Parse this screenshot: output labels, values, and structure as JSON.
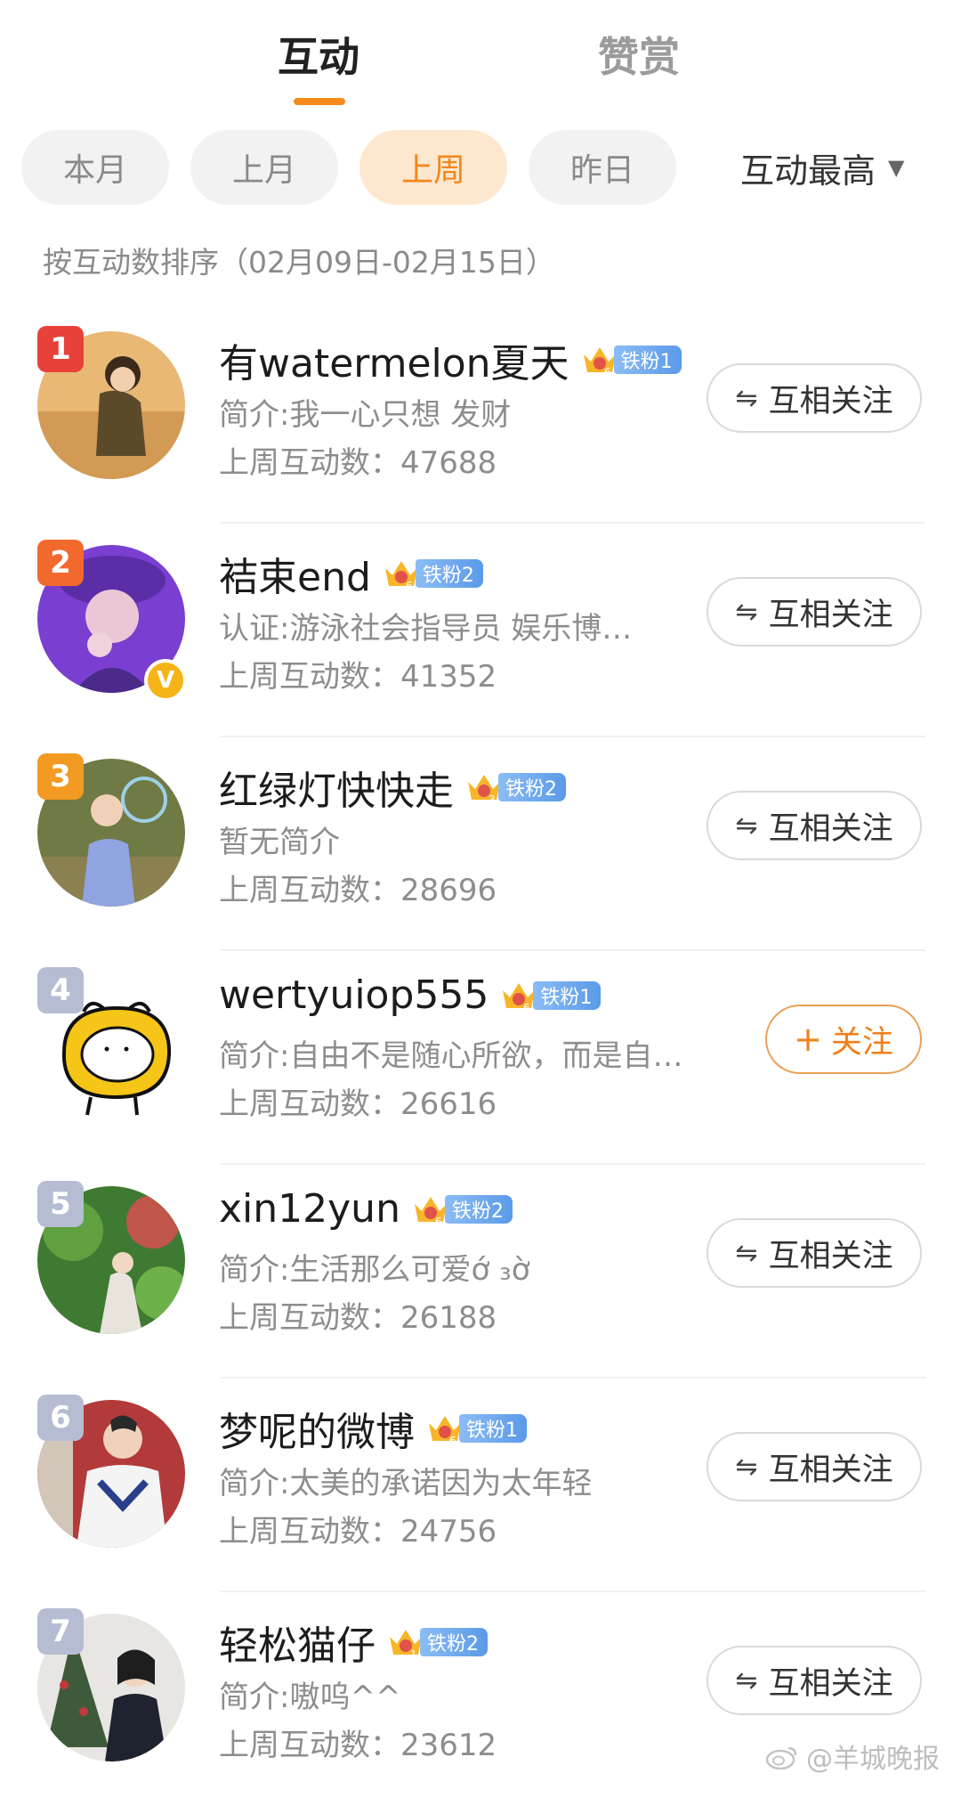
{
  "tabs": {
    "interact": "互动",
    "reward": "赞赏"
  },
  "filters": {
    "chips": [
      "本月",
      "上月",
      "上周",
      "昨日"
    ],
    "active": "上周",
    "sort_label": "互动最高"
  },
  "sort_description": "按互动数排序（02月09日-02月15日）",
  "users": [
    {
      "rank": "1",
      "name": "有watermelon夏天",
      "badge_level": "6",
      "badge": "铁粉1",
      "bio": "简介:我一心只想 发财",
      "count": "上周互动数：47688",
      "button": "互相关注",
      "verified": false
    },
    {
      "rank": "2",
      "name": "袺束end",
      "badge_level": "6",
      "badge": "铁粉2",
      "bio": "认证:游泳社会指导员 娱乐博…",
      "count": "上周互动数：41352",
      "button": "互相关注",
      "verified": true
    },
    {
      "rank": "3",
      "name": "红绿灯快快走",
      "badge_level": "3",
      "badge": "铁粉2",
      "bio": "暂无简介",
      "count": "上周互动数：28696",
      "button": "互相关注",
      "verified": false
    },
    {
      "rank": "4",
      "name": "wertyuiop555",
      "badge_level": "6",
      "badge": "铁粉1",
      "bio": "简介:自由不是随心所欲，而是自…",
      "count": "上周互动数：26616",
      "button": "关注",
      "verified": false
    },
    {
      "rank": "5",
      "name": "xin12yun",
      "badge_level": "6",
      "badge": "铁粉2",
      "bio": "简介:生活那么可爱ớ ₃ờ",
      "count": "上周互动数：26188",
      "button": "互相关注",
      "verified": false
    },
    {
      "rank": "6",
      "name": "梦呢的微博",
      "badge_level": "6",
      "badge": "铁粉1",
      "bio": "简介:太美的承诺因为太年轻",
      "count": "上周互动数：24756",
      "button": "互相关注",
      "verified": false
    },
    {
      "rank": "7",
      "name": "轻松猫仔",
      "badge_level": "1",
      "badge": "铁粉2",
      "bio": "简介:嗷呜^^",
      "count": "上周互动数：23612",
      "button": "互相关注",
      "verified": false
    }
  ],
  "watermark": "@羊城晚报",
  "colors": {
    "accent": "#f68a1c",
    "rank_1": "#e8413a",
    "rank_2": "#f2692e",
    "rank_3": "#f39a22",
    "rank_other": "#b6bdd2"
  }
}
